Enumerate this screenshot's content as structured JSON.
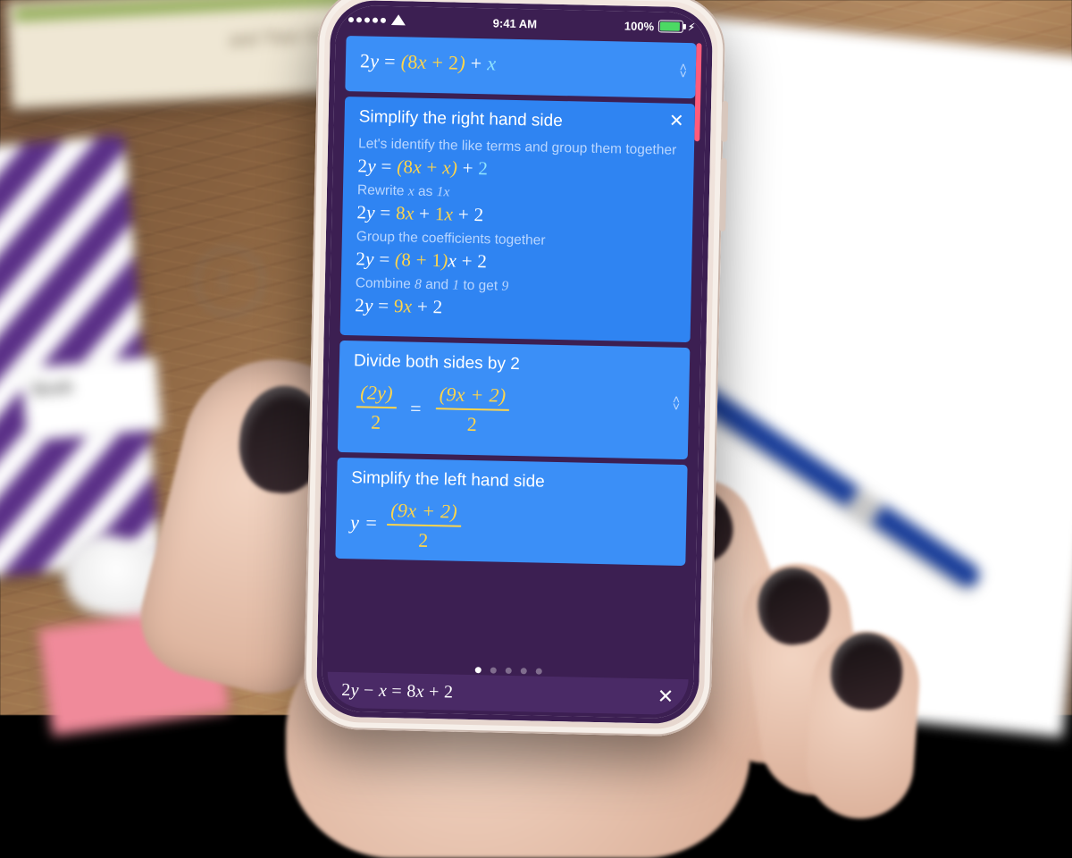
{
  "statusbar": {
    "time": "9:41 AM",
    "battery_pct": "100%",
    "signal_dots_on": 5
  },
  "top_card": {
    "equation_html": "<span class='num'>2</span>y <span class='num'>=</span> <span class='gold'>(<span class='num'>8</span>x <span class='num'>+</span> <span class='num'>2</span>)</span> <span class='num'>+</span> <span class='cyan'>x</span>"
  },
  "expanded": {
    "title": "Simplify the right hand side",
    "steps": [
      {
        "hint_html": "Let's identify the like terms and group them together",
        "eq_html": "<span class='num'>2</span>y <span class='num'>=</span> <span class='gold'>(</span><span class='gold num'>8</span><span class='gold'>x</span> <span class='gold num'>+</span> <span class='gold'>x</span><span class='gold'>)</span> <span class='num'>+</span> <span class='cyan num'>2</span>"
      },
      {
        "hint_html": "Rewrite <span class='mono'>x</span> as <span class='mono'>1x</span>",
        "eq_html": "<span class='num'>2</span>y <span class='num'>=</span> <span class='gold'><span class='num'>8</span>x</span> <span class='num'>+</span> <span class='gold'><span class='num'>1</span>x</span> <span class='num'>+</span> <span class='num'>2</span>"
      },
      {
        "hint_html": "Group the coefficients together",
        "eq_html": "<span class='num'>2</span>y <span class='num'>=</span> <span class='gold'>(<span class='num'>8</span> <span class='num'>+</span> <span class='num'>1</span>)</span>x <span class='num'>+</span> <span class='num'>2</span>"
      },
      {
        "hint_html": "Combine <span class='mono'>8</span> and <span class='mono'>1</span> to get <span class='mono'>9</span>",
        "eq_html": "<span class='num'>2</span>y <span class='num'>=</span> <span class='gold'><span class='num'>9</span>x</span> <span class='num'>+</span> <span class='num'>2</span>"
      }
    ]
  },
  "divide_card": {
    "title_html": "Divide both sides by <span class='mono'>2</span>",
    "lhs_num": "(2y)",
    "lhs_den": "2",
    "rhs_num": "(9x + 2)",
    "rhs_den": "2"
  },
  "simplify_left": {
    "title": "Simplify the left hand side",
    "lead": "y =",
    "rhs_num": "(9x + 2)",
    "rhs_den": "2"
  },
  "pager": {
    "count": 5,
    "active_index": 0
  },
  "bottombar": {
    "equation_html": "<span class='num'>2</span>y <span class='num'>−</span> x <span class='num'>=</span> <span class='num'>8</span>x <span class='num'>+</span> <span class='num'>2</span>"
  },
  "desk": {
    "book_page_text": "and Their Graphs    139",
    "notebook_label": "Book"
  }
}
